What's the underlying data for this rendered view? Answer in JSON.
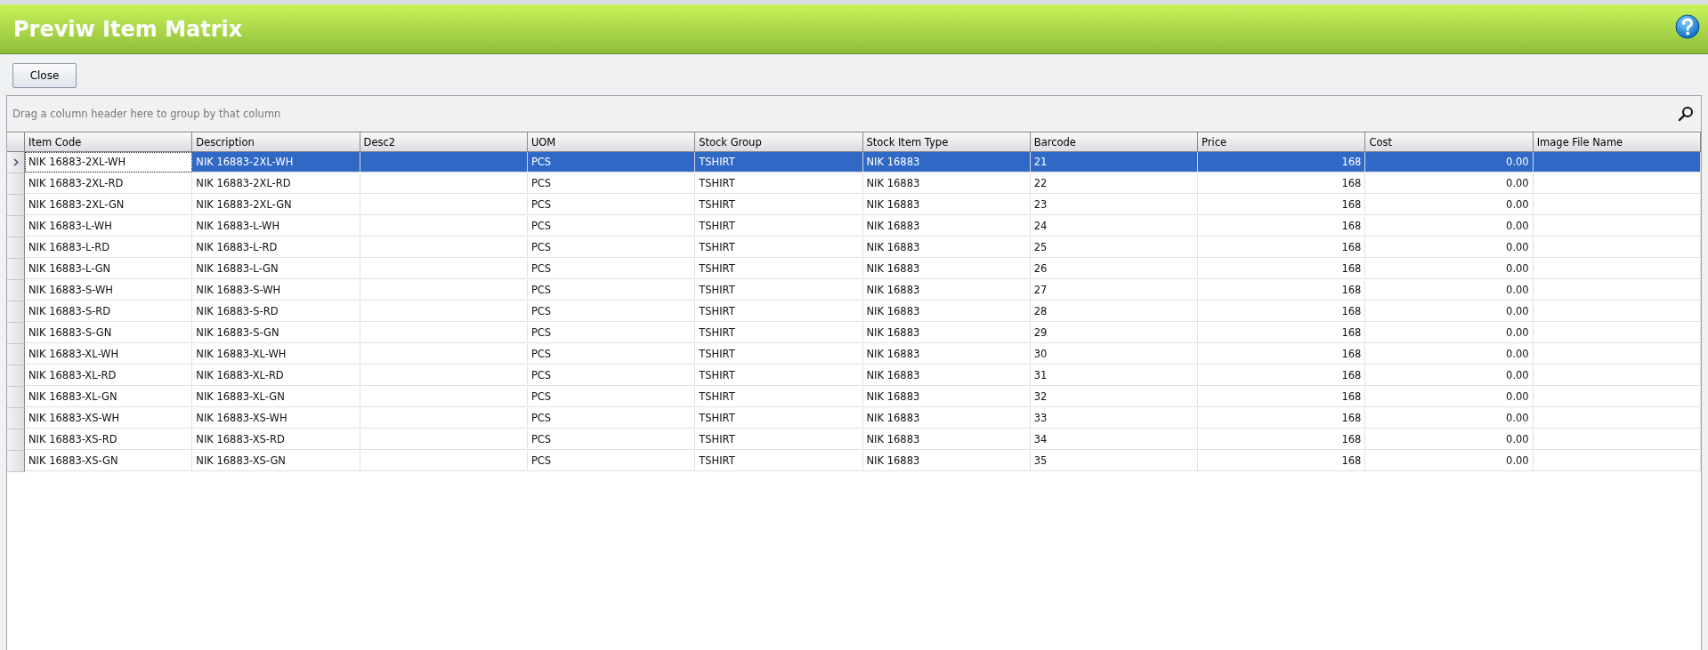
{
  "window": {
    "title": "Previw Item Matrix"
  },
  "toolbar": {
    "buttons": [
      "Close"
    ]
  },
  "grid": {
    "group_panel_hint": "Drag a column header here to group by that column",
    "columns": [
      {
        "label": "Item Code",
        "kind": "text"
      },
      {
        "label": "Description",
        "kind": "text"
      },
      {
        "label": "Desc2",
        "kind": "text"
      },
      {
        "label": "UOM",
        "kind": "text"
      },
      {
        "label": "Stock Group",
        "kind": "text"
      },
      {
        "label": "Stock Item Type",
        "kind": "text"
      },
      {
        "label": "Barcode",
        "kind": "text"
      },
      {
        "label": "Price",
        "kind": "number"
      },
      {
        "label": "Cost",
        "kind": "number"
      },
      {
        "label": "Image File Name",
        "kind": "text"
      }
    ],
    "rows": [
      {
        "selected": true,
        "focused": true,
        "cells": [
          "NIK 16883-2XL-WH",
          "NIK 16883-2XL-WH",
          null,
          "PCS",
          "TSHIRT",
          "NIK 16883",
          "21",
          "168",
          "0.00",
          null
        ]
      },
      {
        "selected": false,
        "focused": false,
        "cells": [
          "NIK 16883-2XL-RD",
          "NIK 16883-2XL-RD",
          null,
          "PCS",
          "TSHIRT",
          "NIK 16883",
          "22",
          "168",
          "0.00",
          null
        ]
      },
      {
        "selected": false,
        "focused": false,
        "cells": [
          "NIK 16883-2XL-GN",
          "NIK 16883-2XL-GN",
          null,
          "PCS",
          "TSHIRT",
          "NIK 16883",
          "23",
          "168",
          "0.00",
          null
        ]
      },
      {
        "selected": false,
        "focused": false,
        "cells": [
          "NIK 16883-L-WH",
          "NIK 16883-L-WH",
          null,
          "PCS",
          "TSHIRT",
          "NIK 16883",
          "24",
          "168",
          "0.00",
          null
        ]
      },
      {
        "selected": false,
        "focused": false,
        "cells": [
          "NIK 16883-L-RD",
          "NIK 16883-L-RD",
          null,
          "PCS",
          "TSHIRT",
          "NIK 16883",
          "25",
          "168",
          "0.00",
          null
        ]
      },
      {
        "selected": false,
        "focused": false,
        "cells": [
          "NIK 16883-L-GN",
          "NIK 16883-L-GN",
          null,
          "PCS",
          "TSHIRT",
          "NIK 16883",
          "26",
          "168",
          "0.00",
          null
        ]
      },
      {
        "selected": false,
        "focused": false,
        "cells": [
          "NIK 16883-S-WH",
          "NIK 16883-S-WH",
          null,
          "PCS",
          "TSHIRT",
          "NIK 16883",
          "27",
          "168",
          "0.00",
          null
        ]
      },
      {
        "selected": false,
        "focused": false,
        "cells": [
          "NIK 16883-S-RD",
          "NIK 16883-S-RD",
          null,
          "PCS",
          "TSHIRT",
          "NIK 16883",
          "28",
          "168",
          "0.00",
          null
        ]
      },
      {
        "selected": false,
        "focused": false,
        "cells": [
          "NIK 16883-S-GN",
          "NIK 16883-S-GN",
          null,
          "PCS",
          "TSHIRT",
          "NIK 16883",
          "29",
          "168",
          "0.00",
          null
        ]
      },
      {
        "selected": false,
        "focused": false,
        "cells": [
          "NIK 16883-XL-WH",
          "NIK 16883-XL-WH",
          null,
          "PCS",
          "TSHIRT",
          "NIK 16883",
          "30",
          "168",
          "0.00",
          null
        ]
      },
      {
        "selected": false,
        "focused": false,
        "cells": [
          "NIK 16883-XL-RD",
          "NIK 16883-XL-RD",
          null,
          "PCS",
          "TSHIRT",
          "NIK 16883",
          "31",
          "168",
          "0.00",
          null
        ]
      },
      {
        "selected": false,
        "focused": false,
        "cells": [
          "NIK 16883-XL-GN",
          "NIK 16883-XL-GN",
          null,
          "PCS",
          "TSHIRT",
          "NIK 16883",
          "32",
          "168",
          "0.00",
          null
        ]
      },
      {
        "selected": false,
        "focused": false,
        "cells": [
          "NIK 16883-XS-WH",
          "NIK 16883-XS-WH",
          null,
          "PCS",
          "TSHIRT",
          "NIK 16883",
          "33",
          "168",
          "0.00",
          null
        ]
      },
      {
        "selected": false,
        "focused": false,
        "cells": [
          "NIK 16883-XS-RD",
          "NIK 16883-XS-RD",
          null,
          "PCS",
          "TSHIRT",
          "NIK 16883",
          "34",
          "168",
          "0.00",
          null
        ]
      },
      {
        "selected": false,
        "focused": false,
        "cells": [
          "NIK 16883-XS-GN",
          "NIK 16883-XS-GN",
          null,
          "PCS",
          "TSHIRT",
          "NIK 16883",
          "35",
          "168",
          "0.00",
          null
        ]
      }
    ]
  }
}
